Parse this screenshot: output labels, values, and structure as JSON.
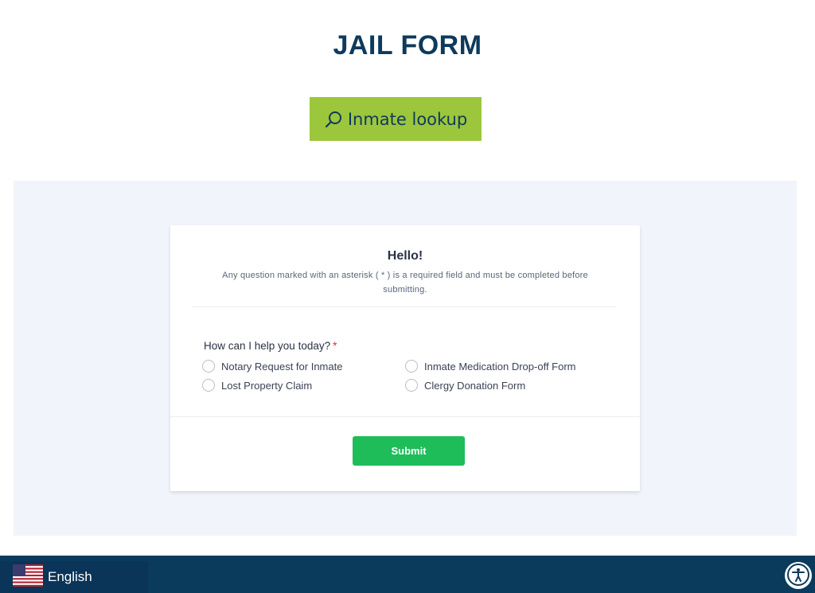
{
  "header": {
    "title": "JAIL FORM",
    "lookup_label": "Inmate lookup"
  },
  "form": {
    "greeting": "Hello!",
    "description": "Any question marked with an asterisk ( * ) is a required field and must be completed before submitting.",
    "question": "How can I help you today?",
    "required_marker": "*",
    "options": [
      "Notary Request for Inmate",
      "Inmate Medication Drop-off Form",
      "Lost Property Claim",
      "Clergy Donation Form"
    ],
    "submit_label": "Submit"
  },
  "footer": {
    "language": "English"
  },
  "icons": {
    "lookup": "search-icon",
    "language": "us-flag-icon",
    "accessibility": "accessibility-icon"
  },
  "colors": {
    "title": "#0e3a5c",
    "lookup_bg": "#9cc63b",
    "band_bg": "#f2f4fb",
    "submit_bg": "#1fbd5a",
    "required": "#d93025",
    "footer_bg": "#0b3b5c"
  }
}
